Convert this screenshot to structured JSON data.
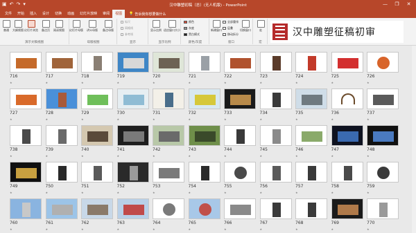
{
  "window": {
    "title": "汉中雕塑初稿（总）(无人机版) - PowerPoint",
    "controls": [
      "—",
      "❐",
      "✕"
    ]
  },
  "tabs": [
    "文件",
    "开始",
    "插入",
    "设计",
    "切换",
    "动画",
    "幻灯片放映",
    "审阅",
    "视图"
  ],
  "active_tab": "视图",
  "tell_me": "告诉我你想要做什么",
  "ribbon": {
    "groups": [
      "演示文稿视图",
      "母版视图",
      "显示",
      "显示比例",
      "颜色/灰度",
      "窗口"
    ],
    "buttons": [
      "普通",
      "大纲视图",
      "幻灯片浏览",
      "备注页",
      "阅读视图",
      "幻灯片母版",
      "讲义母版",
      "备注母版",
      "显示比例",
      "适应窗口大小",
      "新建窗口",
      "切换窗口",
      "宏"
    ],
    "checks": [
      "标尺",
      "网格线",
      "参考线"
    ],
    "color_options": [
      "颜色",
      "灰度",
      "黑白模式"
    ],
    "window_options": [
      "全部重排",
      "层叠",
      "移动拆分"
    ],
    "macro_group": "宏"
  },
  "banner": {
    "text": "汉中雕塑征稿初审"
  },
  "slides": [
    {
      "n": "716",
      "bg": "#ffffff",
      "fig": "#c56a2a",
      "shape": "wide"
    },
    {
      "n": "717",
      "bg": "#ffffff",
      "fig": "#a0643a",
      "shape": "wide"
    },
    {
      "n": "718",
      "bg": "#ffffff",
      "fig": "#8a7f74",
      "shape": "tall"
    },
    {
      "n": "719",
      "bg": "#3f86c6",
      "fig": "#d8d8d8",
      "shape": "wide"
    },
    {
      "n": "720",
      "bg": "#dfe6d8",
      "fig": "#6d6254",
      "shape": "wide"
    },
    {
      "n": "721",
      "bg": "#ffffff",
      "fig": "#9aa0a6",
      "shape": "tall"
    },
    {
      "n": "722",
      "bg": "#ffffff",
      "fig": "#b0522e",
      "shape": "wide"
    },
    {
      "n": "723",
      "bg": "#ffffff",
      "fig": "#5a3b2a",
      "shape": "tall"
    },
    {
      "n": "724",
      "bg": "#ffffff",
      "fig": "#c23a2a",
      "shape": "tall"
    },
    {
      "n": "725",
      "bg": "#ffffff",
      "fig": "#d32f2f",
      "shape": "wide"
    },
    {
      "n": "726",
      "bg": "#ffffff",
      "fig": "#d8642a",
      "shape": "round"
    },
    {
      "n": "727",
      "bg": "#ffffff",
      "fig": "#d96a2a",
      "shape": "wide"
    },
    {
      "n": "728",
      "bg": "#4a90d9",
      "fig": "#a85a3a",
      "shape": "tall"
    },
    {
      "n": "729",
      "bg": "#ffffff",
      "fig": "#6fbf5a",
      "shape": "wide"
    },
    {
      "n": "730",
      "bg": "#e6eef2",
      "fig": "#8fbcd4",
      "shape": "wide"
    },
    {
      "n": "731",
      "bg": "#f3f0e8",
      "fig": "#4a6e8a",
      "shape": "tall"
    },
    {
      "n": "732",
      "bg": "#d8e8f0",
      "fig": "#d6c83a",
      "shape": "wide"
    },
    {
      "n": "733",
      "bg": "#1a1a1a",
      "fig": "#b88a4a",
      "shape": "wide"
    },
    {
      "n": "734",
      "bg": "#ffffff",
      "fig": "#3a3a3a",
      "shape": "tall"
    },
    {
      "n": "735",
      "bg": "#cfdde8",
      "fig": "#6f7a80",
      "shape": "wide"
    },
    {
      "n": "736",
      "bg": "#ffffff",
      "fig": "#6a4a2a",
      "shape": "arc"
    },
    {
      "n": "737",
      "bg": "#ffffff",
      "fig": "#5a5a5a",
      "shape": "wide"
    },
    {
      "n": "738",
      "bg": "#ffffff",
      "fig": "#4a4a4a",
      "shape": "tall"
    },
    {
      "n": "739",
      "bg": "#ffffff",
      "fig": "#6a6a6a",
      "shape": "tall"
    },
    {
      "n": "740",
      "bg": "#d4c8b0",
      "fig": "#5a4a3a",
      "shape": "wide"
    },
    {
      "n": "741",
      "bg": "#1e1e1e",
      "fig": "#7a7a7a",
      "shape": "wide"
    },
    {
      "n": "742",
      "bg": "#b8c8a8",
      "fig": "#6a6a6a",
      "shape": "wide"
    },
    {
      "n": "743",
      "bg": "#6f8f4a",
      "fig": "#3a4a2a",
      "shape": "wide"
    },
    {
      "n": "744",
      "bg": "#ffffff",
      "fig": "#3a3a3a",
      "shape": "tall"
    },
    {
      "n": "745",
      "bg": "#ffffff",
      "fig": "#8a8a8a",
      "shape": "tall"
    },
    {
      "n": "746",
      "bg": "#ffffff",
      "fig": "#8aaa6a",
      "shape": "wide"
    },
    {
      "n": "747",
      "bg": "#0e1220",
      "fig": "#3a6ab0",
      "shape": "wide"
    },
    {
      "n": "748",
      "bg": "#111111",
      "fig": "#4a7ac0",
      "shape": "wide"
    },
    {
      "n": "749",
      "bg": "#101010",
      "fig": "#c8a040",
      "shape": "wide"
    },
    {
      "n": "750",
      "bg": "#ffffff",
      "fig": "#2a2a2a",
      "shape": "tall"
    },
    {
      "n": "751",
      "bg": "#ffffff",
      "fig": "#5a5a5a",
      "shape": "tall"
    },
    {
      "n": "752",
      "bg": "#2a2a2a",
      "fig": "#9a9a9a",
      "shape": "tall"
    },
    {
      "n": "753",
      "bg": "#ffffff",
      "fig": "#7a7a7a",
      "shape": "wide"
    },
    {
      "n": "754",
      "bg": "#ffffff",
      "fig": "#2a2a2a",
      "shape": "tall"
    },
    {
      "n": "755",
      "bg": "#ffffff",
      "fig": "#4a4a4a",
      "shape": "round"
    },
    {
      "n": "756",
      "bg": "#ffffff",
      "fig": "#5a5a5a",
      "shape": "tall"
    },
    {
      "n": "757",
      "bg": "#ffffff",
      "fig": "#3a3a3a",
      "shape": "tall"
    },
    {
      "n": "758",
      "bg": "#ffffff",
      "fig": "#4a4a4a",
      "shape": "tall"
    },
    {
      "n": "759",
      "bg": "#ffffff",
      "fig": "#3a3a3a",
      "shape": "round"
    },
    {
      "n": "760",
      "bg": "#8ab4e0",
      "fig": "#c8c8c8",
      "shape": "tall"
    },
    {
      "n": "761",
      "bg": "#9cc4e8",
      "fig": "#b0b0b0",
      "shape": "wide"
    },
    {
      "n": "762",
      "bg": "#c8d8e8",
      "fig": "#8a7a6a",
      "shape": "wide"
    },
    {
      "n": "763",
      "bg": "#b8d0e8",
      "fig": "#c04a4a",
      "shape": "wide"
    },
    {
      "n": "764",
      "bg": "#ffffff",
      "fig": "#7a7a7a",
      "shape": "round"
    },
    {
      "n": "765",
      "bg": "#a8c8e8",
      "fig": "#c0504a",
      "shape": "round"
    },
    {
      "n": "766",
      "bg": "#ffffff",
      "fig": "#8a8a8a",
      "shape": "wide"
    },
    {
      "n": "767",
      "bg": "#ffffff",
      "fig": "#3a3a3a",
      "shape": "tall"
    },
    {
      "n": "768",
      "bg": "#ffffff",
      "fig": "#3a3a3a",
      "shape": "tall"
    },
    {
      "n": "769",
      "bg": "#1a1a1a",
      "fig": "#b07a4a",
      "shape": "wide"
    },
    {
      "n": "770",
      "bg": "#ffffff",
      "fig": "#9a9a9a",
      "shape": "tall"
    }
  ],
  "accent": "#b7472a"
}
